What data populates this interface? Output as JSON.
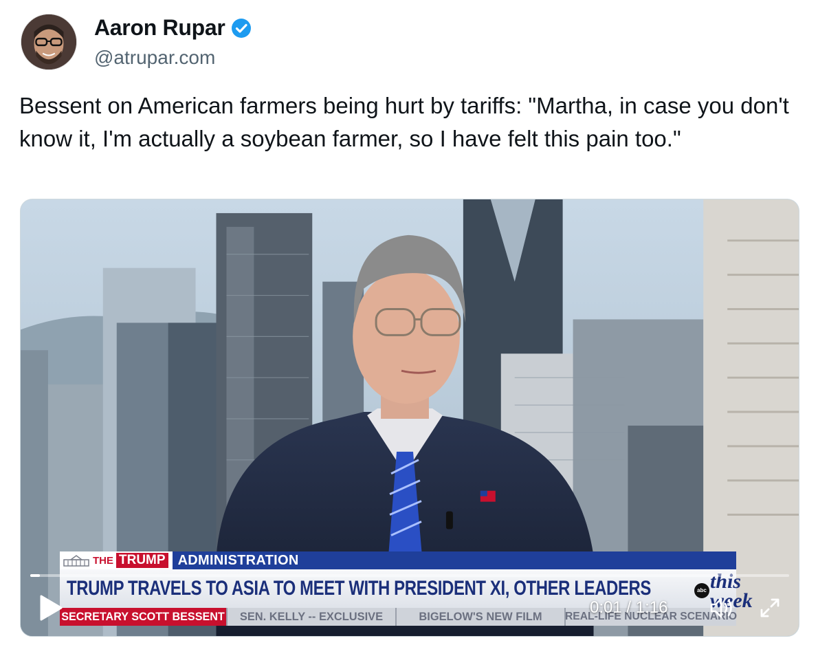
{
  "author": {
    "name": "Aaron Rupar",
    "handle": "@atrupar.com",
    "verified": true
  },
  "post": {
    "text": "Bessent on American farmers being hurt by tariffs: \"Martha, in case you don't know it, I'm actually a soybean farmer, so I have felt this pain too.\""
  },
  "video": {
    "lower_third": {
      "tag_the": "THE",
      "tag_trump": "TRUMP",
      "tag_admin": "ADMINISTRATION",
      "headline": "TRUMP TRAVELS TO ASIA TO MEET WITH PRESIDENT XI, OTHER LEADERS",
      "network_logo": "abc",
      "show_logo": "this week",
      "ticker": [
        "SECRETARY SCOTT BESSENT",
        "SEN. KELLY -- EXCLUSIVE",
        "BIGELOW'S NEW FILM",
        "REAL-LIFE NUCLEAR SCENARIO"
      ]
    },
    "time_display": "0:01 / 1:16",
    "progress": 0.013,
    "icons": {
      "play": "play-icon",
      "volume": "volume-icon",
      "fullscreen": "fullscreen-icon"
    }
  },
  "colors": {
    "verified": "#1d9bf0",
    "handle": "#536471",
    "lt_blue": "#1f3f9a",
    "lt_red": "#c8102e"
  }
}
